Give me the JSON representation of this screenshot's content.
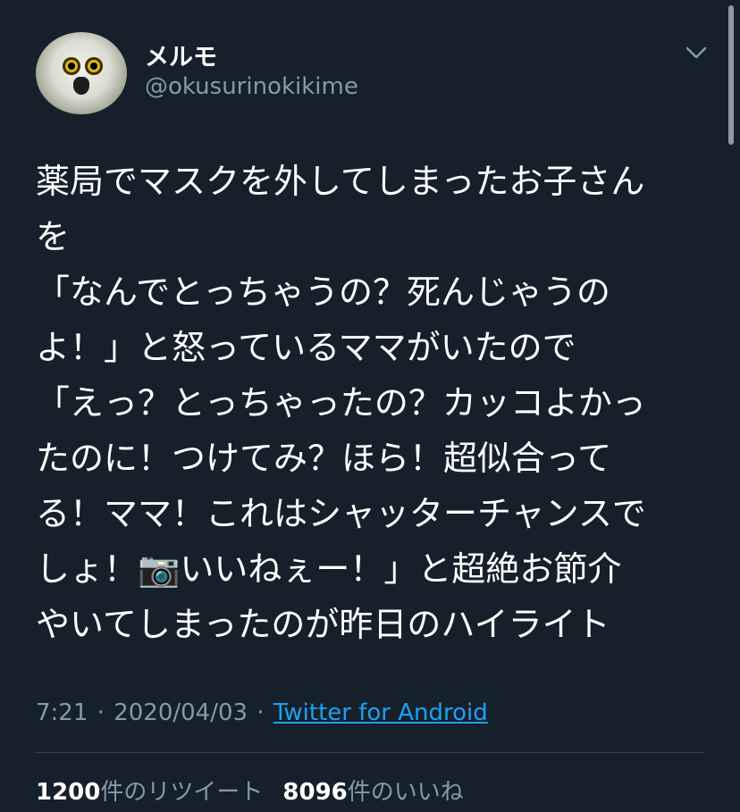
{
  "user": {
    "display_name": "メルモ",
    "handle": "@okusurinokikime"
  },
  "tweet": {
    "lines": [
      "薬局でマスクを外してしまったお子さん",
      "を",
      "「なんでとっちゃうの？死んじゃうの",
      "よ！」と怒っているママがいたので",
      "「えっ？とっちゃったの？カッコよかっ",
      "たのに！つけてみ？ほら！超似合って",
      "る！ママ！これはシャッターチャンスで",
      "しょ！📷いいねぇー！」と超絶お節介",
      "やいてしまったのが昨日のハイライト"
    ]
  },
  "meta": {
    "time": "7:21",
    "separator": "·",
    "date": "2020/04/03",
    "source": "Twitter for Android"
  },
  "stats": {
    "retweets_count": "1200",
    "retweets_label": "件のリツイート",
    "likes_count": "8096",
    "likes_label": "件のいいね"
  },
  "icons": {
    "menu": "chevron-down-icon",
    "avatar": "owl-avatar"
  },
  "colors": {
    "background": "#15202b",
    "text": "#ffffff",
    "secondary": "#8899a6",
    "link": "#1da1f2",
    "divider": "#38444d"
  }
}
